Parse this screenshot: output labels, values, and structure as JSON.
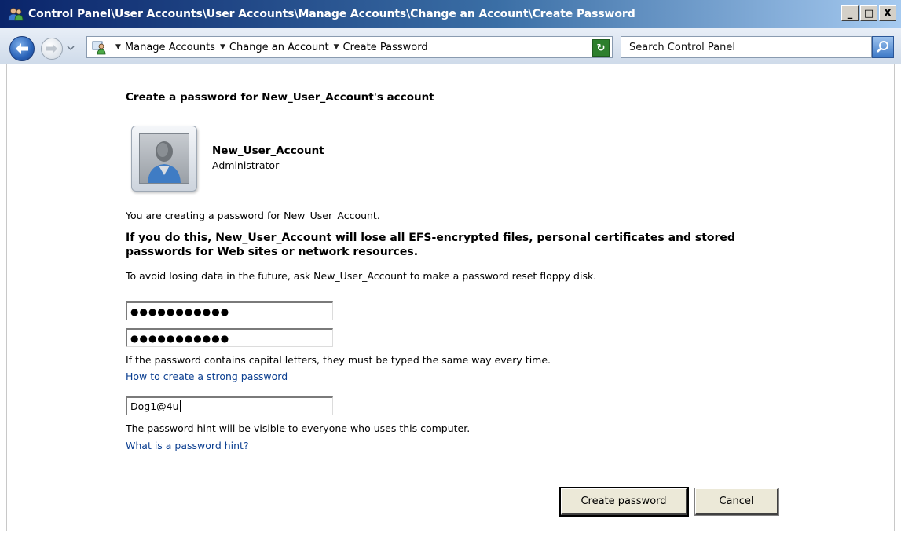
{
  "window": {
    "title": "Control Panel\\User Accounts\\User Accounts\\Manage Accounts\\Change an Account\\Create Password",
    "minimize": "_",
    "maximize": "□",
    "close": "X"
  },
  "address_bar": {
    "crumbs": [
      "Manage Accounts",
      "Change an Account",
      "Create Password"
    ],
    "search_placeholder": "Search Control Panel"
  },
  "page": {
    "heading": "Create a password for New_User_Account's account",
    "user": {
      "name": "New_User_Account",
      "role": "Administrator"
    },
    "info_text": "You are creating a password for New_User_Account.",
    "warning_text": "If you do this, New_User_Account will lose all EFS-encrypted files, personal certificates and stored passwords for Web sites or network resources.",
    "advice_text": "To avoid losing data in the future, ask New_User_Account to make a password reset floppy disk.",
    "password_value": "●●●●●●●●●●●",
    "confirm_value": "●●●●●●●●●●●",
    "caps_note": "If the password contains capital letters, they must be typed the same way every time.",
    "strong_link": "How to create a strong password",
    "hint_value": "Dog1@4u",
    "hint_note": "The password hint will be visible to everyone who uses this computer.",
    "hint_link": "What is a password hint?",
    "create_button": "Create password",
    "cancel_button": "Cancel"
  },
  "colors": {
    "link": "#0b3f91",
    "titlebar_start": "#0a246a",
    "titlebar_end": "#a6caf0"
  }
}
